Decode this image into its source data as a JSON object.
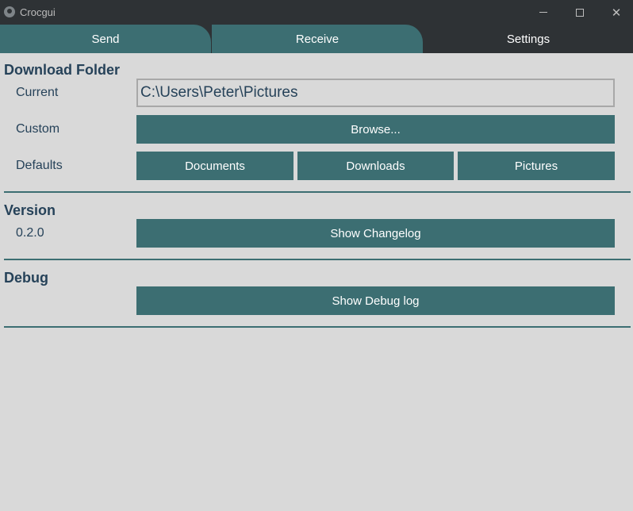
{
  "window": {
    "title": "Crocgui"
  },
  "tabs": [
    {
      "label": "Send"
    },
    {
      "label": "Receive"
    },
    {
      "label": "Settings"
    }
  ],
  "download_folder": {
    "title": "Download Folder",
    "current_label": "Current",
    "current_value": "C:\\Users\\Peter\\Pictures",
    "custom_label": "Custom",
    "browse_label": "Browse...",
    "defaults_label": "Defaults",
    "defaults": [
      "Documents",
      "Downloads",
      "Pictures"
    ]
  },
  "version": {
    "title": "Version",
    "value": "0.2.0",
    "changelog_label": "Show Changelog"
  },
  "debug": {
    "title": "Debug",
    "debug_log_label": "Show Debug log"
  },
  "colors": {
    "accent": "#3c6e72",
    "titlebar": "#2e3235",
    "background": "#d9d9d9",
    "text": "#264259"
  }
}
